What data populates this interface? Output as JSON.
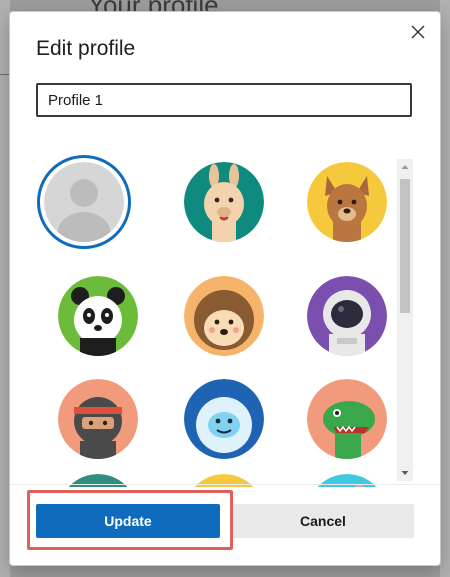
{
  "background": {
    "page_heading": "Your profile"
  },
  "dialog": {
    "title": "Edit profile",
    "close_icon": "close-icon",
    "name_field": {
      "value": "Profile 1",
      "placeholder": ""
    },
    "avatars": [
      {
        "name": "default-person",
        "selected": true
      },
      {
        "name": "llama"
      },
      {
        "name": "dog"
      },
      {
        "name": "panda"
      },
      {
        "name": "hedgehog"
      },
      {
        "name": "astronaut"
      },
      {
        "name": "ninja"
      },
      {
        "name": "yeti"
      },
      {
        "name": "dinosaur"
      },
      {
        "name": "avatar-teal-partial"
      },
      {
        "name": "avatar-yellow-partial"
      },
      {
        "name": "avatar-cyan-partial"
      }
    ],
    "buttons": {
      "update": "Update",
      "cancel": "Cancel"
    }
  },
  "colors": {
    "accent": "#0f6cbd",
    "highlight": "#e0615b"
  }
}
